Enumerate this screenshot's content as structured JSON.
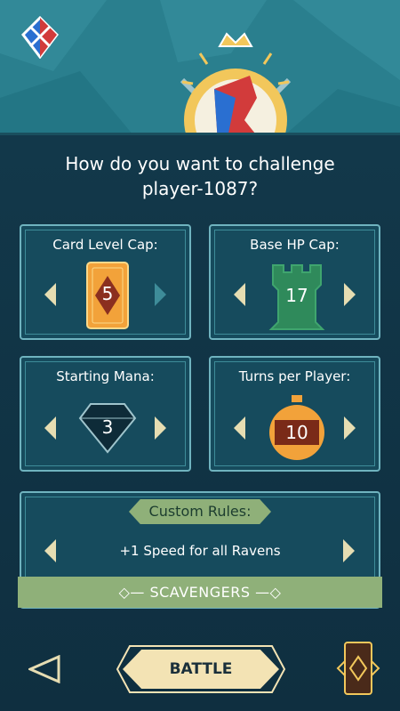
{
  "header": {
    "logo_icon": "crossed-swords-shield-icon",
    "emblem_icon": "crowned-raven-emblem-icon"
  },
  "question": {
    "line1": "How do you want to challenge",
    "line2": "player-1087?"
  },
  "card_level_cap": {
    "label": "Card Level Cap:",
    "value": "5",
    "icon": "card-icon"
  },
  "base_hp_cap": {
    "label": "Base HP Cap:",
    "value": "17",
    "icon": "tower-icon"
  },
  "starting_mana": {
    "label": "Starting Mana:",
    "value": "3",
    "icon": "gem-icon"
  },
  "turns_per_player": {
    "label": "Turns per Player:",
    "value": "10",
    "icon": "stopwatch-icon"
  },
  "custom_rules": {
    "label": "Custom Rules:",
    "rule": "+1 Speed for all Ravens",
    "deck": "SCAVENGERS"
  },
  "footer": {
    "battle_label": "BATTLE"
  },
  "colors": {
    "panel_border": "#6fb3bf",
    "accent_green": "#8fb079",
    "card_orange": "#f2a23a",
    "tower_green": "#2f8a5b",
    "button_cream": "#f3e3b4"
  }
}
